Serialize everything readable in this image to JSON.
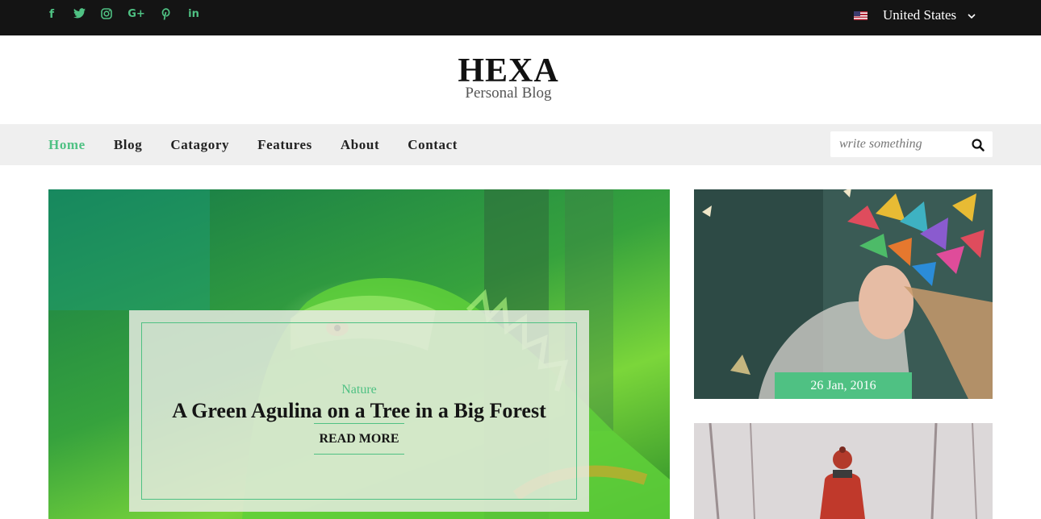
{
  "topbar": {
    "social_icons": [
      "facebook-icon",
      "twitter-icon",
      "instagram-icon",
      "google-plus-icon",
      "pinterest-icon",
      "linkedin-icon"
    ],
    "country": "United States",
    "accent_color": "#4fc183"
  },
  "logo": {
    "title": "HEXA",
    "subtitle": "Personal Blog"
  },
  "nav": {
    "items": [
      {
        "label": "Home",
        "active": true
      },
      {
        "label": "Blog"
      },
      {
        "label": "Catagory"
      },
      {
        "label": "Features"
      },
      {
        "label": "About"
      },
      {
        "label": "Contact"
      }
    ]
  },
  "search": {
    "placeholder": "write something"
  },
  "hero": {
    "category": "Nature",
    "title": "A Green Agulina on a Tree in a Big Forest",
    "read_more": "READ MORE"
  },
  "side_posts": [
    {
      "date": "26 Jan, 2016"
    }
  ]
}
